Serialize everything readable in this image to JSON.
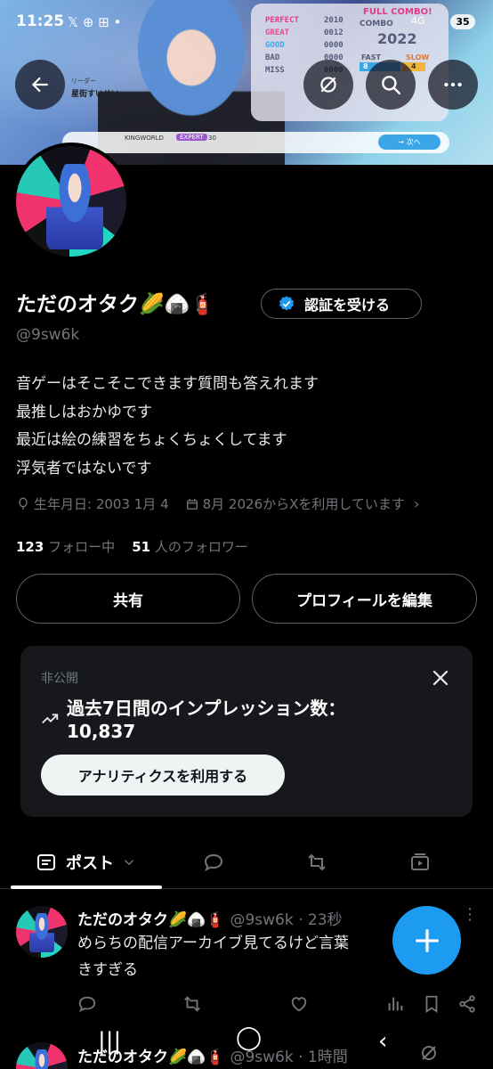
{
  "status_bar": {
    "time": "11:25",
    "icons": "𝕏 ⊕ ⊞ •",
    "network": "4G",
    "battery": "35"
  },
  "banner": {
    "grades": [
      {
        "label": "PERFECT",
        "value": "2010",
        "color": "#e23b8a"
      },
      {
        "label": "GREAT",
        "value": "0012",
        "color": "#e0508a"
      },
      {
        "label": "GOOD",
        "value": "0000",
        "color": "#3aa6e8"
      },
      {
        "label": "BAD",
        "value": "0000",
        "color": "#555d7a"
      },
      {
        "label": "MISS",
        "value": "0000",
        "color": "#555d7a"
      }
    ],
    "full_combo": "FULL COMBO!",
    "combo_label": "COMBO",
    "combo_value": "2022",
    "fast_label": "FAST",
    "fast_value": "8",
    "slow_label": "SLOW",
    "slow_value": "4",
    "leader_label": "リーダー",
    "leader_name": "星街すいせい",
    "song_title": "KINGWORLD",
    "difficulty": "EXPERT",
    "level": "30",
    "next_label": "→ 次へ"
  },
  "header_buttons": {
    "back": "back-arrow-icon",
    "grok": "grok-icon",
    "search": "search-icon",
    "more": "more-icon"
  },
  "profile": {
    "name": "ただのオタク🌽🍙🧯",
    "verify_label": "認証を受ける",
    "handle": "@9sw6k",
    "bio": [
      "音ゲーはそこそこできます質問も答えれます",
      "最推しはおかゆです",
      "最近は絵の練習をちょくちょくしてます",
      "浮気者ではないです"
    ],
    "birthday": "生年月日: 2003 1月 4",
    "joined": "8月 2026からXを利用しています",
    "following_count": "123",
    "following_label": "フォロー中",
    "followers_count": "51",
    "followers_label": "人のフォロワー",
    "share_label": "共有",
    "edit_label": "プロフィールを編集"
  },
  "analytics_card": {
    "private_label": "非公開",
    "title": "過去7日間のインプレッション数：",
    "value": "10,837",
    "button_label": "アナリティクスを利用する"
  },
  "tabs": {
    "posts_label": "ポスト"
  },
  "posts": [
    {
      "name": "ただのオタク🌽🍙🧯",
      "meta": "@9sw6k · 23秒",
      "text_lines": [
        "めらちの配信アーカイブ見てるけど言葉",
        "きすぎる"
      ]
    },
    {
      "name": "ただのオタク🌽🍙🧯",
      "meta": "@9sw6k · 1時間"
    }
  ],
  "colors": {
    "accent": "#1d9bf0",
    "background": "#000000",
    "muted": "#71767b",
    "border": "#536471"
  }
}
